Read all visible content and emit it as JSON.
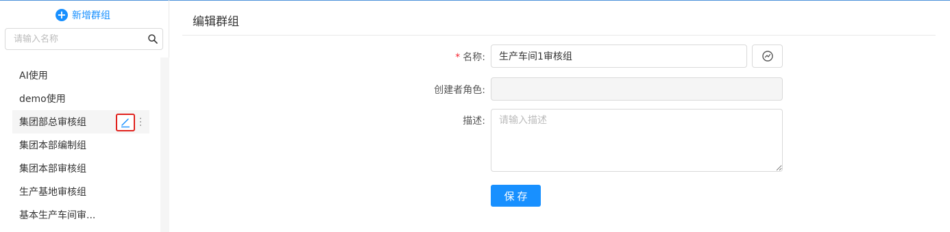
{
  "sidebar": {
    "add_group_label": "新增群组",
    "search": {
      "placeholder": "请输入名称",
      "value": ""
    },
    "items": [
      {
        "label": "AI使用"
      },
      {
        "label": "demo使用"
      },
      {
        "label": "集团部总审核组"
      },
      {
        "label": "集团本部编制组"
      },
      {
        "label": "集团本部审核组"
      },
      {
        "label": "生产基地审核组"
      },
      {
        "label": "基本生产车间审..."
      }
    ],
    "active_index": 2
  },
  "main": {
    "title": "编辑群组",
    "form": {
      "name": {
        "required_mark": "*",
        "label": "名称:",
        "value": "生产车间1审核组"
      },
      "creator_role": {
        "label": "创建者角色:",
        "value": ""
      },
      "description": {
        "label": "描述:",
        "placeholder": "请输入描述",
        "value": ""
      },
      "save_label": "保存"
    }
  },
  "colors": {
    "accent": "#1890ff",
    "highlight_border": "#e0201c",
    "required": "#f5222d"
  },
  "icons": {
    "add": "plus-circle-icon",
    "search": "search-icon",
    "edit": "edit-pen-icon",
    "more": "more-vertical-icon",
    "name_action": "refresh-circle-icon"
  }
}
